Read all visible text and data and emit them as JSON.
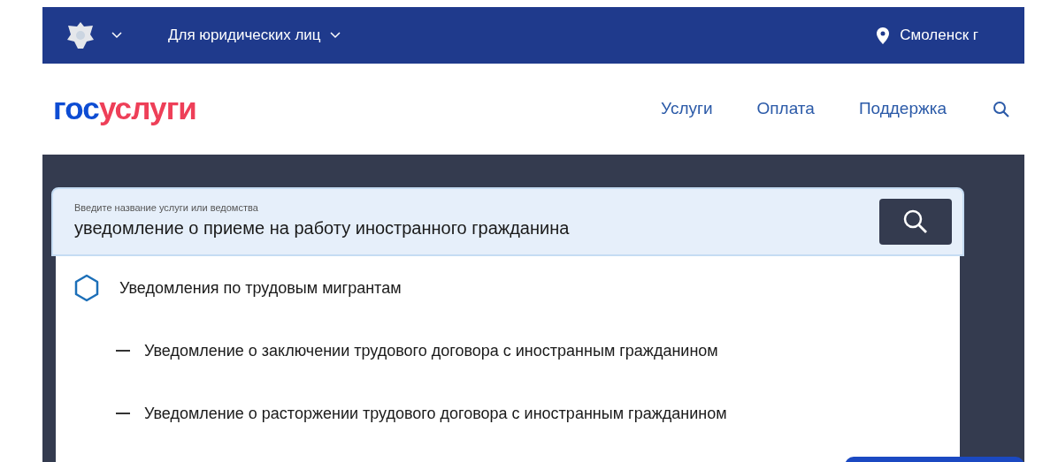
{
  "top_bar": {
    "audience": "Для юридических лиц",
    "location": "Смоленск г"
  },
  "header": {
    "logo": {
      "part_1": "гос",
      "part_2": "услуги"
    },
    "nav": [
      "Услуги",
      "Оплата",
      "Поддержка"
    ]
  },
  "search": {
    "label": "Введите название услуги или ведомства",
    "value": "уведомление о приеме на работу иностранного гражданина"
  },
  "results": [
    {
      "kind": "category",
      "label": "Уведомления по трудовым мигрантам"
    },
    {
      "kind": "service",
      "label": "Уведомление о заключении трудового договора с иностранным гражданином"
    },
    {
      "kind": "service",
      "label": "Уведомление о расторжении трудового договора с иностранным гражданином"
    }
  ]
}
